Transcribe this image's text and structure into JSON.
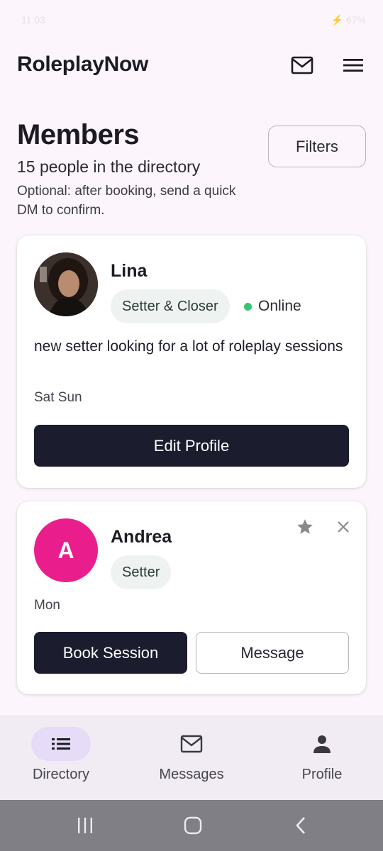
{
  "status_bar": {
    "time": "11:03",
    "right": "⚡ 67%"
  },
  "app": {
    "title": "RoleplayNow"
  },
  "directory": {
    "title": "Members",
    "count_text": "15 people in the directory",
    "note": "Optional: after booking, send a quick DM to confirm.",
    "filters_label": "Filters"
  },
  "members": [
    {
      "name": "Lina",
      "role": "Setter & Closer",
      "status": "Online",
      "bio": "new setter looking for a lot of roleplay sessions",
      "days": "Sat Sun",
      "primary_action": "Edit Profile"
    },
    {
      "name": "Andrea",
      "avatar_letter": "A",
      "avatar_color": "#e91e8c",
      "role": "Setter",
      "days": "Mon",
      "primary_action": "Book Session",
      "secondary_action": "Message"
    }
  ],
  "bottom_nav": {
    "items": [
      {
        "label": "Directory",
        "icon": "list-icon",
        "active": true
      },
      {
        "label": "Messages",
        "icon": "mail-icon",
        "active": false
      },
      {
        "label": "Profile",
        "icon": "person-icon",
        "active": false
      }
    ]
  },
  "colors": {
    "background": "#fcf5fc",
    "primary_button": "#1b1c2e",
    "online": "#34c76f",
    "nav_active_pill": "#e6dcf7"
  }
}
